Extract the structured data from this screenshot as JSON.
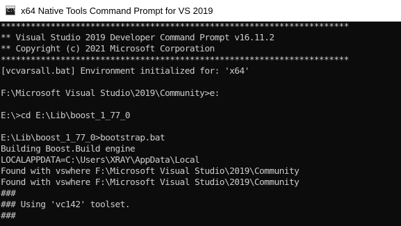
{
  "window": {
    "title": "x64 Native Tools Command Prompt for VS 2019",
    "icon": "command-prompt-icon",
    "icon_glyph": "C:\\"
  },
  "console": {
    "text_color": "#cccccc",
    "background": "#0c0c0c",
    "lines": [
      "**********************************************************************",
      "** Visual Studio 2019 Developer Command Prompt v16.11.2",
      "** Copyright (c) 2021 Microsoft Corporation",
      "**********************************************************************",
      "[vcvarsall.bat] Environment initialized for: 'x64'",
      "",
      "F:\\Microsoft Visual Studio\\2019\\Community>e:",
      "",
      "E:\\>cd E:\\Lib\\boost_1_77_0",
      "",
      "E:\\Lib\\boost_1_77_0>bootstrap.bat",
      "Building Boost.Build engine",
      "LOCALAPPDATA=C:\\Users\\XRAY\\AppData\\Local",
      "Found with vswhere F:\\Microsoft Visual Studio\\2019\\Community",
      "Found with vswhere F:\\Microsoft Visual Studio\\2019\\Community",
      "###",
      "### Using 'vc142' toolset.",
      "###"
    ]
  }
}
